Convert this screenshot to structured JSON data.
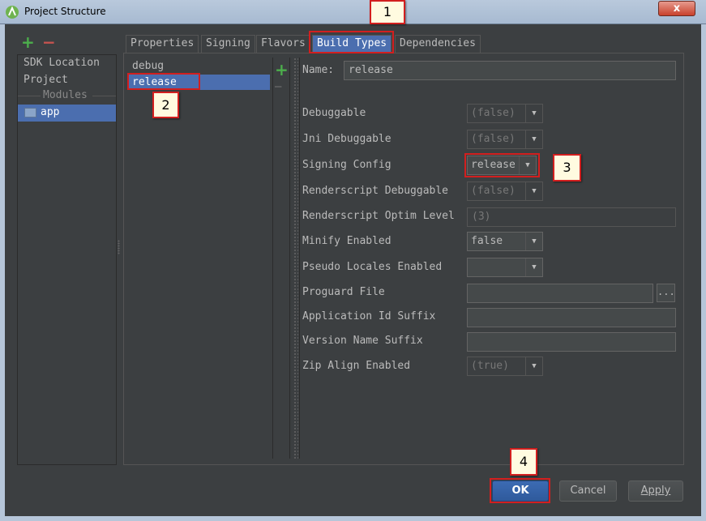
{
  "window": {
    "title": "Project Structure",
    "close_label": "x"
  },
  "toolbar": {
    "add_glyph": "+",
    "remove_glyph": "−"
  },
  "sidebar": {
    "items": [
      {
        "label": "SDK Location"
      },
      {
        "label": "Project"
      }
    ],
    "section_label": "Modules",
    "modules": [
      {
        "label": "app",
        "selected": true
      }
    ]
  },
  "tabs": [
    {
      "label": "Properties"
    },
    {
      "label": "Signing"
    },
    {
      "label": "Flavors"
    },
    {
      "label": "Build Types",
      "active": true
    },
    {
      "label": "Dependencies"
    }
  ],
  "build_types": {
    "items": [
      {
        "label": "debug"
      },
      {
        "label": "release",
        "selected": true
      }
    ],
    "add_glyph": "+",
    "remove_glyph": "—"
  },
  "form": {
    "name_label": "Name:",
    "name_value": "release",
    "fields": [
      {
        "label": "Debuggable",
        "value": "(false)",
        "kind": "combo",
        "disabled": true
      },
      {
        "label": "Jni Debuggable",
        "value": "(false)",
        "kind": "combo",
        "disabled": true
      },
      {
        "label": "Signing Config",
        "value": "release",
        "kind": "combo",
        "disabled": false
      },
      {
        "label": "Renderscript Debuggable",
        "value": "(false)",
        "kind": "combo",
        "disabled": true
      },
      {
        "label": "Renderscript Optim Level",
        "value": "(3)",
        "kind": "text",
        "disabled": true
      },
      {
        "label": "Minify Enabled",
        "value": "false",
        "kind": "combo",
        "disabled": false
      },
      {
        "label": "Pseudo Locales Enabled",
        "value": "",
        "kind": "combo",
        "disabled": false
      },
      {
        "label": "Proguard File",
        "value": "",
        "kind": "file",
        "disabled": false
      },
      {
        "label": "Application Id Suffix",
        "value": "",
        "kind": "text",
        "disabled": false
      },
      {
        "label": "Version Name Suffix",
        "value": "",
        "kind": "text",
        "disabled": false
      },
      {
        "label": "Zip Align Enabled",
        "value": "(true)",
        "kind": "combo",
        "disabled": true
      }
    ],
    "browse_glyph": "..."
  },
  "buttons": {
    "ok": "OK",
    "cancel": "Cancel",
    "apply": "Apply"
  },
  "callouts": [
    "1",
    "2",
    "3",
    "4"
  ],
  "colors": {
    "selection": "#4b6eaf",
    "marker": "#d21f1f",
    "add": "#4cae4c",
    "remove": "#c75450"
  }
}
